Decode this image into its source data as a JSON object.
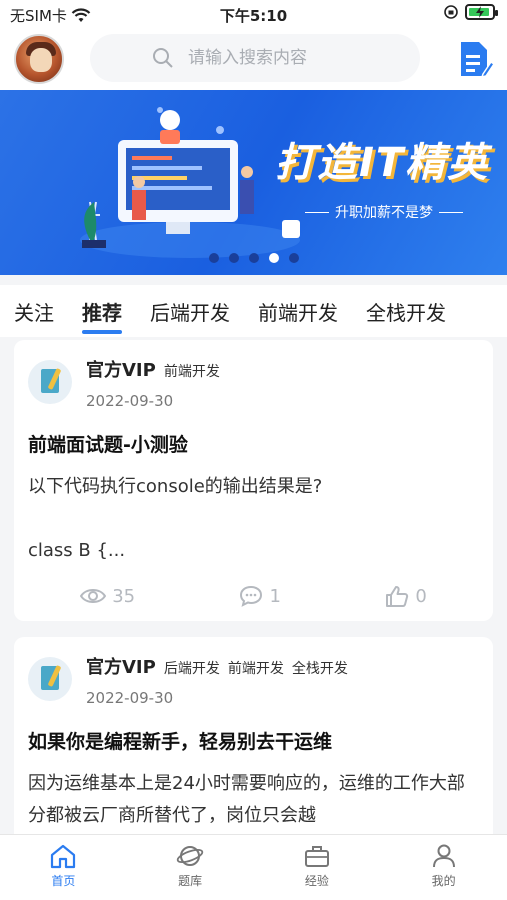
{
  "status_bar": {
    "carrier": "无SIM卡",
    "time": "下午5:10"
  },
  "header": {
    "search_placeholder": "请输入搜索内容"
  },
  "banner": {
    "headline": "打造IT精英",
    "slogan": "升职加薪不是梦",
    "dot_count": 5,
    "active_dot": 4
  },
  "tabs": [
    {
      "label": "关注",
      "active": false
    },
    {
      "label": "推荐",
      "active": true
    },
    {
      "label": "后端开发",
      "active": false
    },
    {
      "label": "前端开发",
      "active": false
    },
    {
      "label": "全栈开发",
      "active": false
    }
  ],
  "posts": [
    {
      "author": "官方VIP",
      "tags": [
        "前端开发"
      ],
      "date": "2022-09-30",
      "title": "前端面试题-小测验",
      "body": "以下代码执行console的输出结果是?\n\nclass B {...",
      "views": "35",
      "comments": "1",
      "likes": "0"
    },
    {
      "author": "官方VIP",
      "tags": [
        "后端开发",
        "前端开发",
        "全栈开发"
      ],
      "date": "2022-09-30",
      "title": "如果你是编程新手，轻易别去干运维",
      "body": "因为运维基本上是24小时需要响应的，运维的工作大部分都被云厂商所替代了，岗位只会越"
    }
  ],
  "bottom_nav": [
    {
      "label": "首页",
      "icon": "home-icon",
      "active": true
    },
    {
      "label": "题库",
      "icon": "planet-icon",
      "active": false
    },
    {
      "label": "经验",
      "icon": "briefcase-icon",
      "active": false
    },
    {
      "label": "我的",
      "icon": "person-icon",
      "active": false
    }
  ],
  "colors": {
    "accent": "#2b7cf0",
    "banner_blue": "#1a5fe0"
  }
}
